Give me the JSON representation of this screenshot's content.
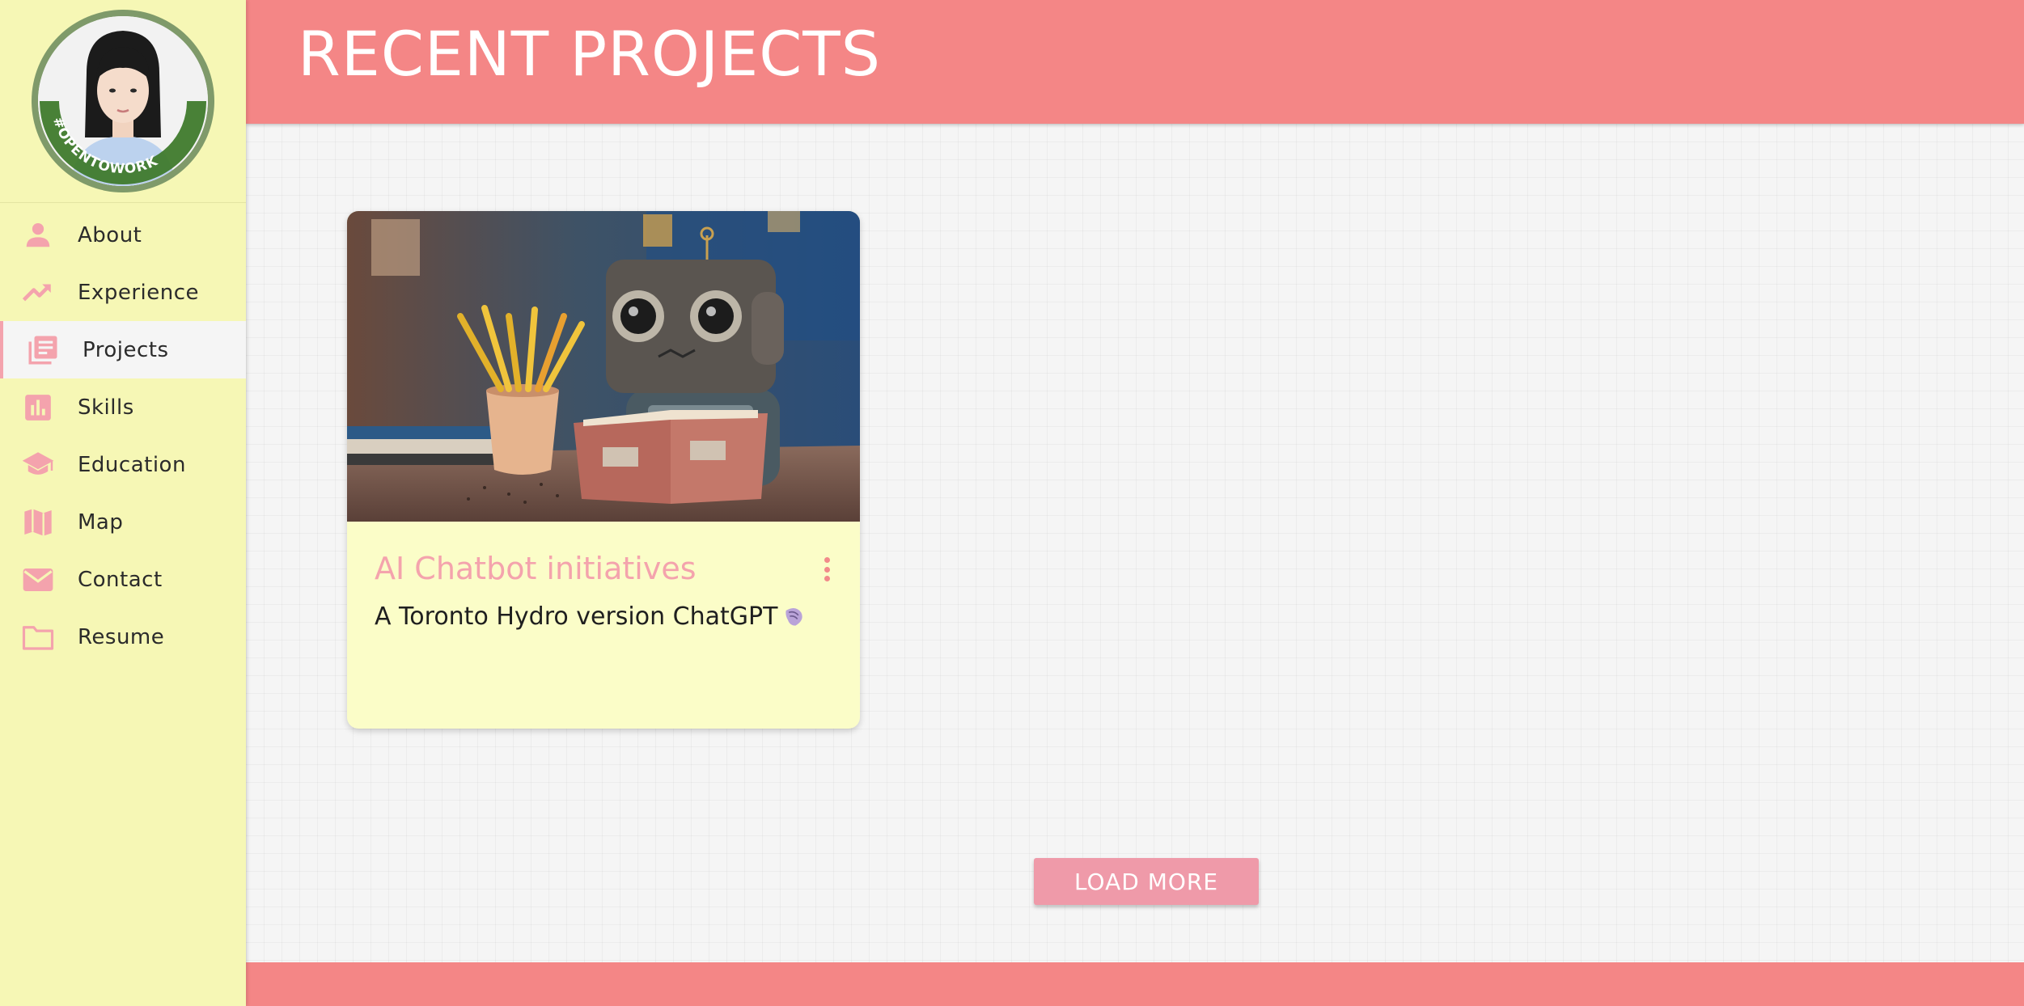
{
  "header": {
    "title": "RECENT PROJECTS"
  },
  "profile": {
    "badge_text": "#OPENTOWORK"
  },
  "sidebar": {
    "items": [
      {
        "label": "About",
        "icon": "person-icon"
      },
      {
        "label": "Experience",
        "icon": "trending-up-icon"
      },
      {
        "label": "Projects",
        "icon": "library-books-icon",
        "active": true
      },
      {
        "label": "Skills",
        "icon": "bar-chart-icon"
      },
      {
        "label": "Education",
        "icon": "graduation-cap-icon"
      },
      {
        "label": "Map",
        "icon": "map-icon"
      },
      {
        "label": "Contact",
        "icon": "mail-icon"
      },
      {
        "label": "Resume",
        "icon": "folder-icon"
      }
    ]
  },
  "projects": [
    {
      "title": "AI Chatbot initiatives",
      "description": "A Toronto Hydro version ChatGPT",
      "image": "robot-reading-book-image"
    }
  ],
  "actions": {
    "load_more_label": "LOAD MORE"
  },
  "colors": {
    "header": "#f48686",
    "sidebar": "#f6f7b5",
    "accent_pink": "#f4a3ad",
    "button": "#ef9aa9",
    "card": "#fbfdc8"
  }
}
